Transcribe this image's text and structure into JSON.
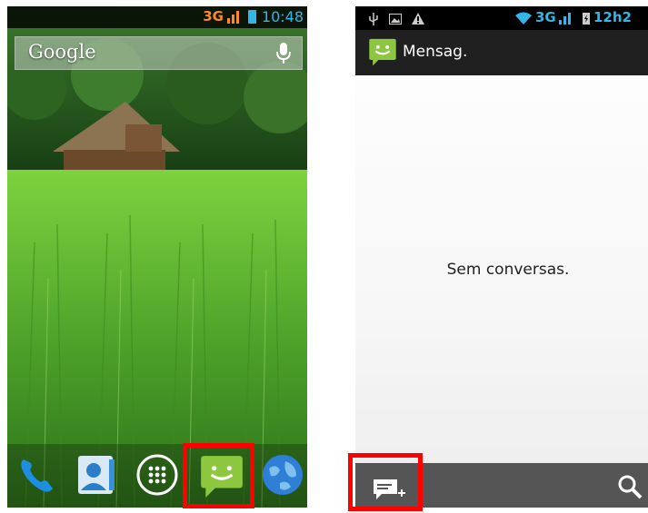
{
  "left_screen": {
    "status_bar": {
      "network": "3G",
      "time": "10:48"
    },
    "search_widget": {
      "label": "Google"
    },
    "dock": [
      "phone",
      "contacts",
      "apps",
      "messaging",
      "browser"
    ]
  },
  "right_screen": {
    "status_bar": {
      "network": "3G",
      "time": "12h2"
    },
    "action_bar": {
      "title": "Mensag."
    },
    "empty_message": "Sem conversas."
  },
  "colors": {
    "highlight": "#ff0000",
    "status_blue": "#33b5e5",
    "messaging_green": "#8dc63f"
  }
}
